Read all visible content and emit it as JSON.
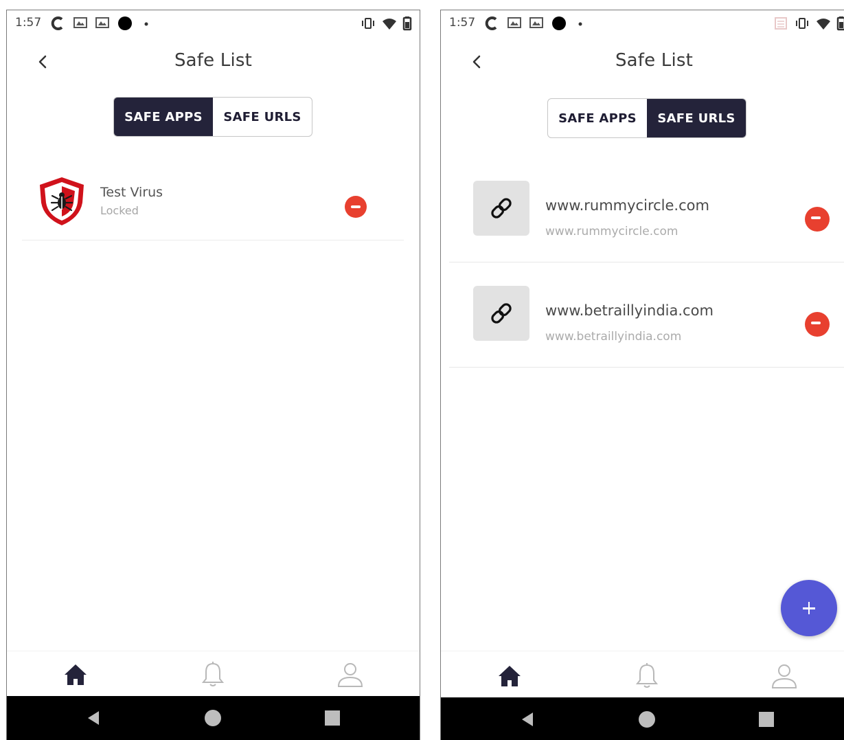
{
  "left_screen": {
    "status_bar": {
      "time": "1:57"
    },
    "title": "Safe List",
    "tabs": [
      {
        "label": "SAFE APPS",
        "active": true
      },
      {
        "label": "SAFE URLS",
        "active": false
      }
    ],
    "apps": [
      {
        "name": "Test Virus",
        "status": "Locked",
        "icon": "shield-bug-icon"
      }
    ],
    "bottom_nav": [
      "home-icon",
      "bell-icon",
      "profile-icon"
    ]
  },
  "right_screen": {
    "status_bar": {
      "time": "1:57"
    },
    "title": "Safe List",
    "tabs": [
      {
        "label": "SAFE APPS",
        "active": false
      },
      {
        "label": "SAFE URLS",
        "active": true
      }
    ],
    "urls": [
      {
        "title": "www.rummycircle.com",
        "subtitle": "www.rummycircle.com",
        "icon": "link-icon"
      },
      {
        "title": "www.betraillyindia.com",
        "subtitle": "www.betraillyindia.com",
        "icon": "link-icon"
      }
    ],
    "fab_icon": "plus-icon",
    "bottom_nav": [
      "home-icon",
      "bell-icon",
      "profile-icon"
    ]
  },
  "colors": {
    "tab_active_bg": "#24233a",
    "remove_red": "#e8402f",
    "fab_blue": "#5558d6",
    "nav_active": "#24233a",
    "nav_inactive": "#b8b8b8"
  }
}
